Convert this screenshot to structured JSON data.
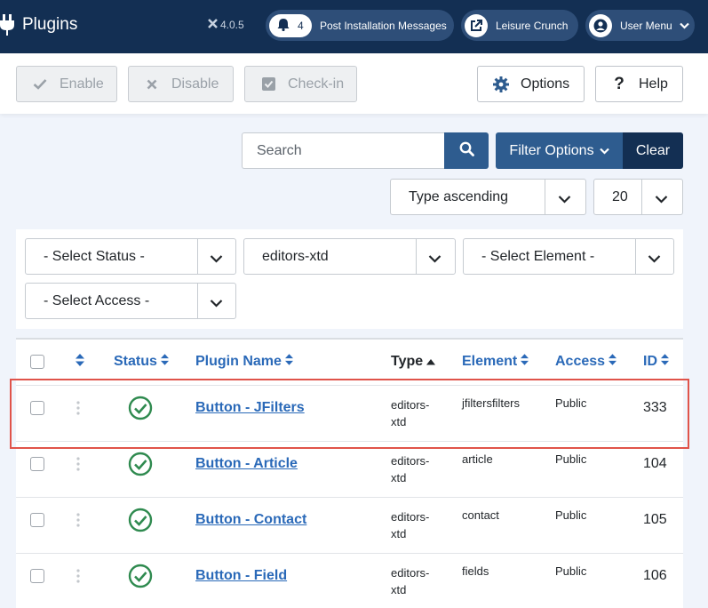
{
  "header": {
    "title": "Plugins",
    "version": "4.0.5",
    "notifications": {
      "count": "4",
      "label": "Post Installation Messages"
    },
    "site_label": "Leisure Crunch",
    "user_menu_label": "User Menu"
  },
  "toolbar": {
    "enable": "Enable",
    "disable": "Disable",
    "checkin": "Check-in",
    "options": "Options",
    "help": "Help"
  },
  "search": {
    "placeholder": "Search",
    "filter_options": "Filter Options",
    "clear": "Clear"
  },
  "ordering": {
    "selected": "Type ascending"
  },
  "limit": {
    "selected": "20"
  },
  "filters": {
    "status": "- Select Status -",
    "folder": "editors-xtd",
    "element": "- Select Element -",
    "access": "- Select Access -"
  },
  "table": {
    "columns": {
      "status": "Status",
      "name": "Plugin Name",
      "type": "Type",
      "element": "Element",
      "access": "Access",
      "id": "ID"
    },
    "rows": [
      {
        "name": "Button - JFilters",
        "type": "editors-xtd",
        "element": "jfiltersfilters",
        "access": "Public",
        "id": "333"
      },
      {
        "name": "Button - Article",
        "type": "editors-xtd",
        "element": "article",
        "access": "Public",
        "id": "104"
      },
      {
        "name": "Button - Contact",
        "type": "editors-xtd",
        "element": "contact",
        "access": "Public",
        "id": "105"
      },
      {
        "name": "Button - Field",
        "type": "editors-xtd",
        "element": "fields",
        "access": "Public",
        "id": "106"
      }
    ]
  },
  "colors": {
    "header_bg": "#132f53",
    "primary": "#2e5c8f",
    "link": "#2a69b8",
    "success": "#2f8a4f",
    "highlight": "#e0534a"
  }
}
